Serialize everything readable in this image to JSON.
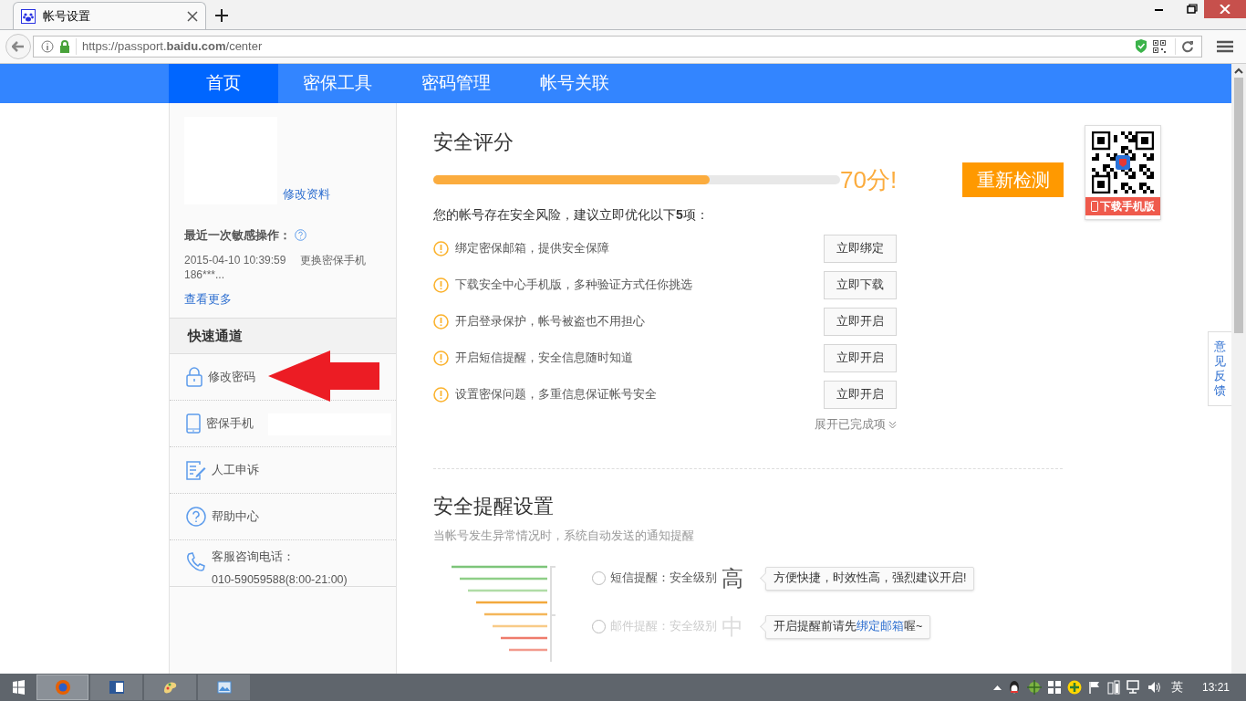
{
  "browser": {
    "tab_title": "帐号设置",
    "url": "https://passport.**baidu.com**/center"
  },
  "nav": [
    {
      "label": "首页",
      "selected": true
    },
    {
      "label": "密保工具",
      "selected": false
    },
    {
      "label": "密码管理",
      "selected": false
    },
    {
      "label": "帐号关联",
      "selected": false
    }
  ],
  "profile": {
    "edit_link": "修改资料"
  },
  "recent": {
    "title": "最近一次敏感操作：",
    "text": "2015-04-10 10:39:59 　更换密保手机 186***...",
    "more": "查看更多"
  },
  "quick": {
    "title": "快速通道",
    "items": [
      {
        "kind": "lock",
        "label": "修改密码"
      },
      {
        "kind": "mobile",
        "label": "密保手机"
      },
      {
        "kind": "form",
        "label": "人工申诉"
      },
      {
        "kind": "help",
        "label": "帮助中心"
      },
      {
        "kind": "call",
        "label": "客服咨询电话：",
        "detail": "010-59059588(8:00-21:00)"
      }
    ]
  },
  "score": {
    "title": "安全评分",
    "level": 0.68,
    "reading": "70分!",
    "button": "重新检测",
    "qr_label": "下载手机版"
  },
  "risk": {
    "text": "您的帐号存在安全风险，建议立即优化以下**5**项：",
    "items": [
      {
        "text": "绑定密保邮箱，提供安全保障",
        "button": "立即绑定"
      },
      {
        "text": "下载安全中心手机版，多种验证方式任你挑选",
        "button": "立即下载"
      },
      {
        "text": "开启登录保护，帐号被盗也不用担心",
        "button": "立即开启"
      },
      {
        "text": "开启短信提醒，安全信息随时知道",
        "button": "立即开启"
      },
      {
        "text": "设置密保问题，多重信息保证帐号安全",
        "button": "立即开启"
      }
    ],
    "expand": "展开已完成项"
  },
  "alerts": {
    "title": "安全提醒设置",
    "subtitle": "当帐号发生异常情况时，系统自动发送的通知提醒",
    "options": [
      {
        "label": "短信提醒：安全级别",
        "grade": "高",
        "selected": false,
        "disabled": false,
        "tip": "方便快捷，时效性高，强烈建议开启!"
      },
      {
        "label": "邮件提醒：安全级别",
        "grade": "中",
        "selected": false,
        "disabled": true,
        "tip": "开启提醒前请先",
        "tip_link": "绑定邮箱",
        "tip_after": "喔~"
      }
    ]
  },
  "feedback": "意见反馈",
  "taskbar": {
    "ime": "英",
    "time": "13:21"
  }
}
